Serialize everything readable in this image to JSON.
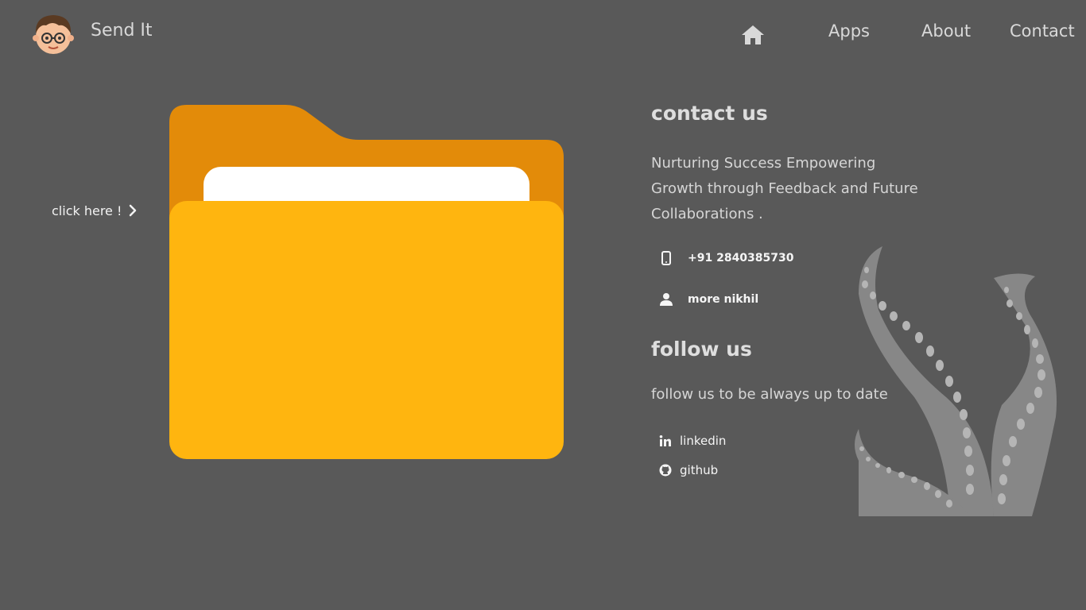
{
  "header": {
    "brand": "Send It",
    "nav": {
      "home_icon": "home-icon",
      "apps": "Apps",
      "about": "About",
      "contact": "Contact"
    }
  },
  "hero": {
    "click_here": "click here !",
    "chevron_icon": "chevron-right-icon",
    "folder_icon": "folder-icon"
  },
  "contact": {
    "title": "contact us",
    "tagline": "Nurturing Success Empowering Growth through Feedback and Future Collaborations .",
    "phone": "+91 2840385730",
    "name": "more nikhil",
    "follow_title": "follow us",
    "follow_text": "follow us to be always up to date",
    "socials": [
      {
        "label": "linkedin",
        "icon": "linkedin-icon"
      },
      {
        "label": "github",
        "icon": "github-icon"
      }
    ]
  },
  "colors": {
    "background": "#595959",
    "folder_back": "#e38b09",
    "folder_front": "#ffb50f",
    "paper": "#ffffff",
    "tentacle": "#878787",
    "sucker": "#b5b5b5"
  }
}
